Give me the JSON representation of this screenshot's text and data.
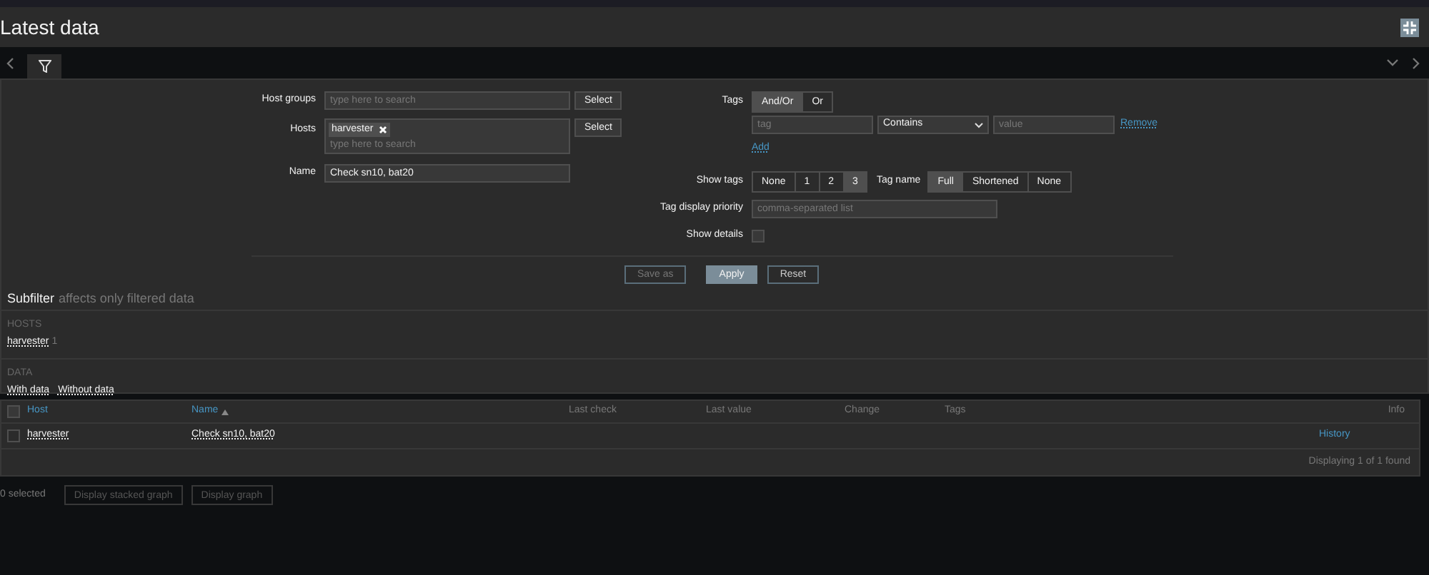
{
  "header": {
    "title": "Latest data"
  },
  "filter": {
    "host_groups": {
      "label": "Host groups",
      "placeholder": "type here to search",
      "button": "Select"
    },
    "hosts": {
      "label": "Hosts",
      "chips": [
        "harvester"
      ],
      "placeholder": "type here to search",
      "button": "Select"
    },
    "name": {
      "label": "Name",
      "value": "Check sn10, bat20"
    },
    "tags": {
      "label": "Tags",
      "modes": [
        {
          "label": "And/Or",
          "selected": true
        },
        {
          "label": "Or",
          "selected": false
        }
      ],
      "rows": [
        {
          "tag_placeholder": "tag",
          "operator": "Contains",
          "value_placeholder": "value",
          "remove": "Remove"
        }
      ],
      "add": "Add"
    },
    "show_tags": {
      "label": "Show tags",
      "options": [
        {
          "label": "None",
          "selected": false
        },
        {
          "label": "1",
          "selected": false
        },
        {
          "label": "2",
          "selected": false
        },
        {
          "label": "3",
          "selected": true
        }
      ]
    },
    "tag_name": {
      "label": "Tag name",
      "options": [
        {
          "label": "Full",
          "selected": true
        },
        {
          "label": "Shortened",
          "selected": false
        },
        {
          "label": "None",
          "selected": false
        }
      ]
    },
    "tag_priority": {
      "label": "Tag display priority",
      "placeholder": "comma-separated list"
    },
    "show_details": {
      "label": "Show details",
      "checked": false
    },
    "buttons": [
      {
        "label": "Save as",
        "kind": "outline",
        "disabled": true
      },
      {
        "label": "Apply",
        "kind": "primary",
        "disabled": false
      },
      {
        "label": "Reset",
        "kind": "outline",
        "disabled": false
      }
    ]
  },
  "subfilter": {
    "title": "Subfilter",
    "note": "affects only filtered data",
    "groups": [
      {
        "heading": "HOSTS",
        "items": [
          {
            "label": "harvester",
            "count": "1"
          }
        ]
      },
      {
        "heading": "DATA",
        "items": [
          {
            "label": "With data"
          },
          {
            "label": "Without data"
          }
        ]
      }
    ]
  },
  "table": {
    "all_checked": false,
    "columns": [
      {
        "label": "Host",
        "sortable": true,
        "sorted": false
      },
      {
        "label": "Name",
        "sortable": true,
        "sorted": true
      },
      {
        "label": "Last check",
        "sortable": false,
        "sorted": false
      },
      {
        "label": "Last value",
        "sortable": false,
        "sorted": false
      },
      {
        "label": "Change",
        "sortable": false,
        "sorted": false
      },
      {
        "label": "Tags",
        "sortable": false,
        "sorted": false
      },
      {
        "label": "Info",
        "sortable": false,
        "sorted": false
      }
    ],
    "rows": [
      {
        "checked": false,
        "host": "harvester",
        "name": "Check sn10, bat20",
        "action": "History"
      }
    ],
    "footer": "Displaying 1 of 1 found"
  },
  "bottom": {
    "selected": "0 selected",
    "buttons": [
      {
        "label": "Display stacked graph",
        "disabled": true
      },
      {
        "label": "Display graph",
        "disabled": true
      }
    ]
  }
}
